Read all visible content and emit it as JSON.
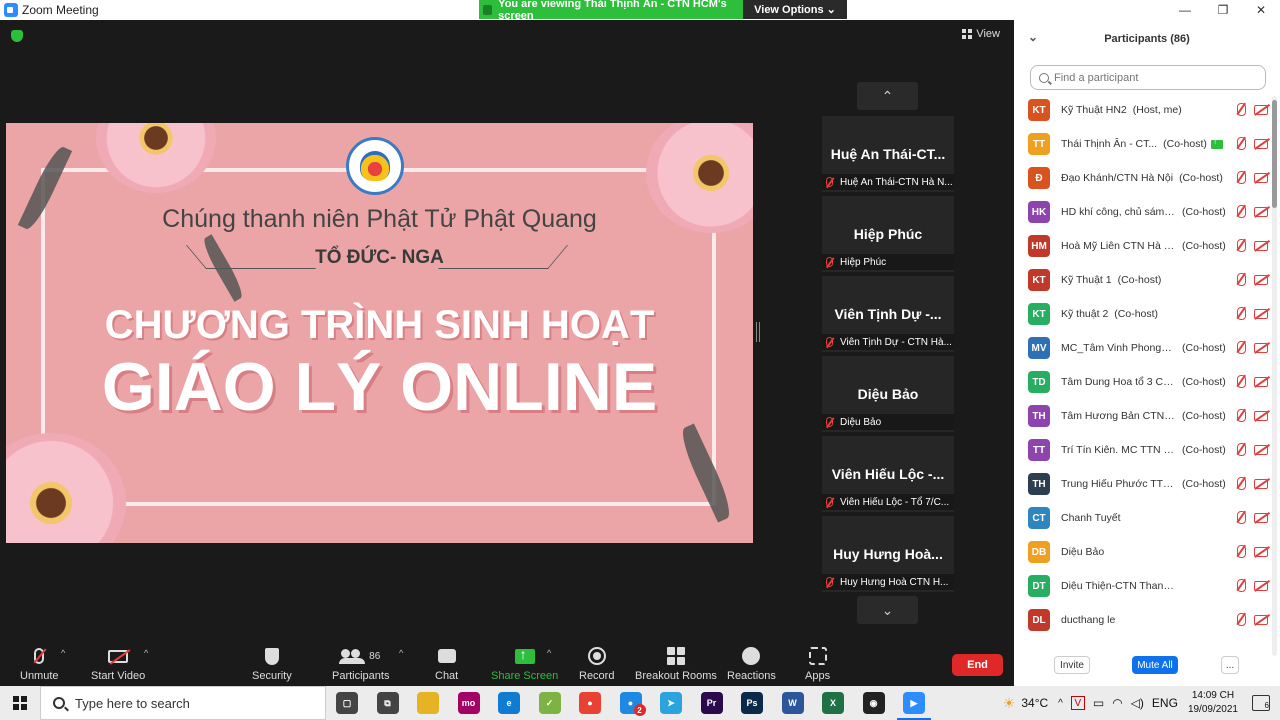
{
  "window": {
    "title": "Zoom Meeting",
    "viewing_banner": "You are viewing Thái Thịnh Ân - CTN HCM's screen",
    "view_options": "View Options ⌄",
    "minimize": "—",
    "restore": "❐",
    "close": "✕"
  },
  "meeting": {
    "view_label": "View"
  },
  "slide": {
    "subtitle": "Chúng thanh niên Phật Tử Phật Quang",
    "group": "TỔ ĐỨC- NGA",
    "heading_line1": "CHƯƠNG TRÌNH SINH HOẠT",
    "heading_line2": "GIÁO LÝ ONLINE"
  },
  "tiles": [
    {
      "name": "Huệ An Thái-CT...",
      "label": "Huệ An Thái-CTN Hà N..."
    },
    {
      "name": "Hiệp Phúc",
      "label": "Hiệp Phúc"
    },
    {
      "name": "Viên Tịnh Dự -...",
      "label": "Viên Tịnh Dự - CTN Hà..."
    },
    {
      "name": "Diệu Bảo",
      "label": "Diệu Bảo"
    },
    {
      "name": "Viên Hiếu Lộc -...",
      "label": "Viên Hiếu Lộc - Tổ 7/C..."
    },
    {
      "name": "Huy Hưng Hoà...",
      "label": "Huy Hưng Hoà CTN H..."
    }
  ],
  "tile_nav": {
    "up": "⌃",
    "down": "⌄"
  },
  "toolbar": {
    "unmute": "Unmute",
    "start_video": "Start Video",
    "security": "Security",
    "participants": "Participants",
    "participants_count": "86",
    "chat": "Chat",
    "share_screen": "Share Screen",
    "record": "Record",
    "breakout_rooms": "Breakout Rooms",
    "reactions": "Reactions",
    "apps": "Apps",
    "end": "End",
    "caret": "^"
  },
  "panel": {
    "title": "Participants (86)",
    "collapse": "⌄",
    "search_placeholder": "Find a participant",
    "participants": [
      {
        "initials": "KT",
        "color": "#d9531e",
        "name": "Kỹ Thuật HN2",
        "role": "(Host, me)",
        "sharing": false
      },
      {
        "initials": "TT",
        "color": "#f0a021",
        "name": "Thái Thịnh Ân - CT...",
        "role": "(Co-host)",
        "sharing": true
      },
      {
        "initials": "Đ",
        "color": "#d9531e",
        "name": "Đạo Khánh/CTN Hà Nội",
        "role": "(Co-host)",
        "sharing": false
      },
      {
        "initials": "HK",
        "color": "#8e44ad",
        "name": "HD khí công, chủ sám t...",
        "role": "(Co-host)",
        "sharing": false
      },
      {
        "initials": "HM",
        "color": "#c0392b",
        "name": "Hoà Mỹ Liên CTN Hà Nội",
        "role": "(Co-host)",
        "sharing": false
      },
      {
        "initials": "KT",
        "color": "#c0392b",
        "name": "Kỹ Thuật 1",
        "role": "(Co-host)",
        "sharing": false
      },
      {
        "initials": "KT",
        "color": "#27ae60",
        "name": "Kỹ thuật 2",
        "role": "(Co-host)",
        "sharing": false
      },
      {
        "initials": "MV",
        "color": "#2e6fb5",
        "name": "MC_Tâm Vinh Phong_T...",
        "role": "(Co-host)",
        "sharing": false
      },
      {
        "initials": "TD",
        "color": "#27ae60",
        "name": "Tâm Dung Hoa tổ 3 CT...",
        "role": "(Co-host)",
        "sharing": false
      },
      {
        "initials": "TH",
        "color": "#8e44ad",
        "name": "Tâm Hương Bản CTN T...",
        "role": "(Co-host)",
        "sharing": false
      },
      {
        "initials": "TT",
        "color": "#8e44ad",
        "name": "Trí Tín Kiên. MC TTN Đ...",
        "role": "(Co-host)",
        "sharing": false
      },
      {
        "initials": "TH",
        "color": "#2c3e50",
        "name": "Trung Hiếu Phước TTN...",
        "role": "(Co-host)",
        "sharing": false
      },
      {
        "initials": "CT",
        "color": "#2e86c1",
        "name": "Chanh Tuyết",
        "role": "",
        "sharing": false
      },
      {
        "initials": "DB",
        "color": "#f0a021",
        "name": "Diệu Bảo",
        "role": "",
        "sharing": false
      },
      {
        "initials": "DT",
        "color": "#27ae60",
        "name": "Diệu Thiện-CTN Thanh Hoá",
        "role": "",
        "sharing": false
      },
      {
        "initials": "DL",
        "color": "#c0392b",
        "name": "ducthang le",
        "role": "",
        "sharing": false
      }
    ],
    "invite": "Invite",
    "mute_all": "Mute All",
    "more": "..."
  },
  "taskbar": {
    "search_placeholder": "Type here to search",
    "weather": "34°C",
    "language": "ENG",
    "time": "14:09 CH",
    "date": "19/09/2021",
    "notification_count": "6",
    "chrome_badge": "2",
    "apps": [
      {
        "name": "task-view",
        "color": "#444",
        "glyph": "▢"
      },
      {
        "name": "widgets",
        "color": "#444",
        "glyph": "⧉"
      },
      {
        "name": "file-explorer",
        "color": "#e6b325",
        "glyph": ""
      },
      {
        "name": "momo",
        "color": "#a50064",
        "glyph": "mo"
      },
      {
        "name": "edge",
        "color": "#0f7bd1",
        "glyph": "e"
      },
      {
        "name": "greenshot",
        "color": "#7cb342",
        "glyph": "✓"
      },
      {
        "name": "chrome",
        "color": "#e94235",
        "glyph": "●"
      },
      {
        "name": "chrome-profile",
        "color": "#1e88e5",
        "glyph": "●"
      },
      {
        "name": "telegram",
        "color": "#2aa3df",
        "glyph": "➤"
      },
      {
        "name": "premiere",
        "color": "#2a0a4a",
        "glyph": "Pr"
      },
      {
        "name": "photoshop",
        "color": "#0b2a4a",
        "glyph": "Ps"
      },
      {
        "name": "word",
        "color": "#2b579a",
        "glyph": "W"
      },
      {
        "name": "excel",
        "color": "#1e7145",
        "glyph": "X"
      },
      {
        "name": "obs",
        "color": "#222",
        "glyph": "◉"
      },
      {
        "name": "zoom",
        "color": "#2d8cff",
        "glyph": "▶"
      }
    ]
  }
}
